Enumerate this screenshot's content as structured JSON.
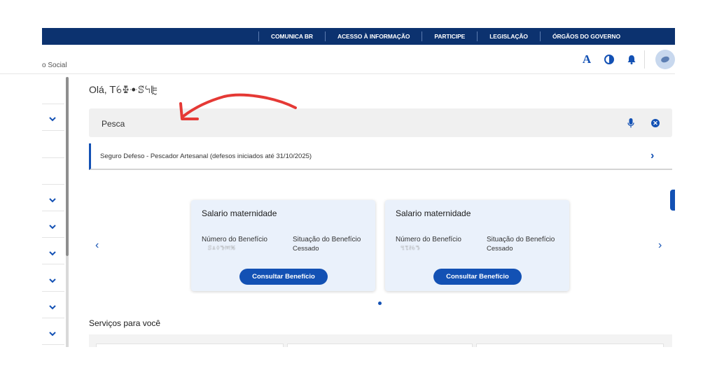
{
  "govbar": {
    "links": [
      "COMUNICA BR",
      "ACESSO À INFORMAÇÃO",
      "PARTICIPE",
      "LEGISLAÇÃO",
      "ÓRGÃOS DO GOVERNO"
    ]
  },
  "header": {
    "breadcrumb": "o Social",
    "font_icon_label": "A",
    "icons": [
      "font-size-icon",
      "contrast-icon",
      "bell-icon",
      "avatar"
    ]
  },
  "greeting": {
    "prefix": "Olá, ",
    "name": "ꓔꕃꔁꔹꕷꕪꕟ"
  },
  "search": {
    "value": "Pesca",
    "icons": [
      "microphone-icon",
      "clear-icon"
    ]
  },
  "suggestion": {
    "text": "Seguro Defeso - Pescador Artesanal (defesos iniciados até 31/10/2025)"
  },
  "cards": [
    {
      "title": "Salario maternidade",
      "benefit_number_label": "Número do Benefício",
      "benefit_number_value": "ꕶꕊꕺꔥꔟꕑ",
      "status_label": "Situação do Benefício",
      "status_value": "Cessado",
      "button": "Consultar Benefício"
    },
    {
      "title": "Salario maternidade",
      "benefit_number_label": "Número do Benefício",
      "benefit_number_value": "ꔇꔂꔧꕃꔤ",
      "status_label": "Situação do Benefício",
      "status_value": "Cessado",
      "button": "Consultar Benefício"
    }
  ],
  "services": {
    "title": "Serviços para você"
  },
  "colors": {
    "gov_blue": "#0c326f",
    "primary": "#1351b4",
    "annotation_red": "#e53935"
  }
}
